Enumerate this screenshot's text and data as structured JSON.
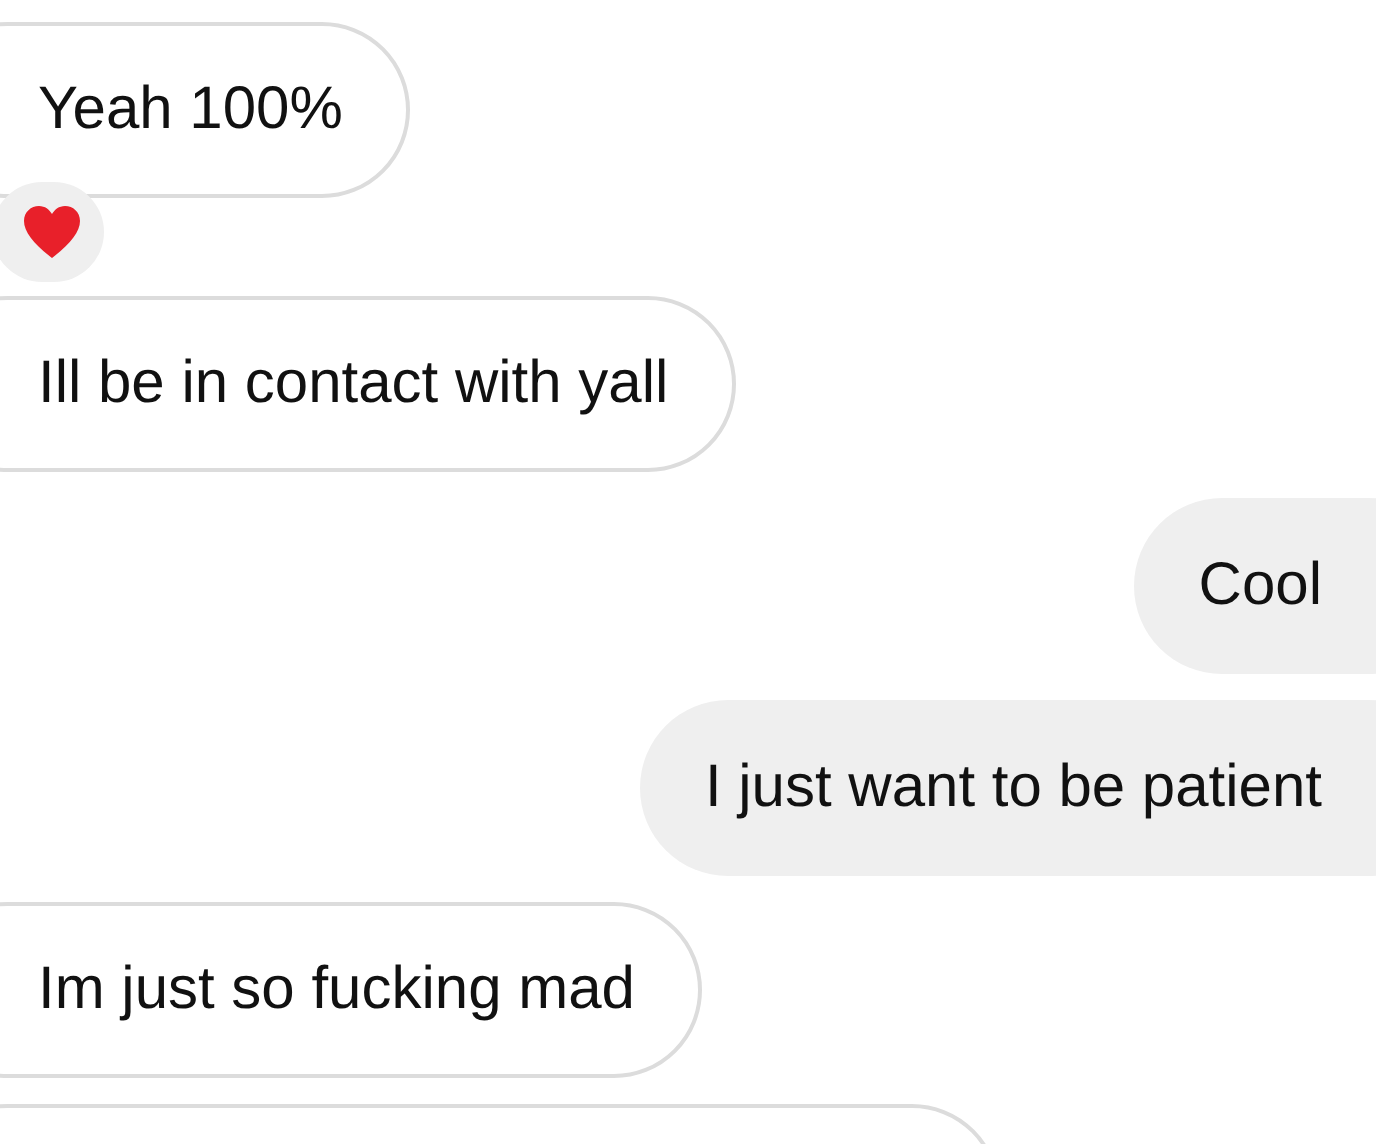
{
  "messages": [
    {
      "kind": "incoming",
      "text": "Yeah 100%",
      "reacted": true
    },
    {
      "kind": "incoming",
      "text": "Ill be in contact with yall",
      "reacted": false
    },
    {
      "kind": "outgoing",
      "text": "Cool",
      "reacted": false
    },
    {
      "kind": "outgoing",
      "text": "I just want to be patient",
      "reacted": false
    },
    {
      "kind": "incoming",
      "text": "Im just so fucking mad",
      "reacted": false
    }
  ],
  "more_below": true
}
